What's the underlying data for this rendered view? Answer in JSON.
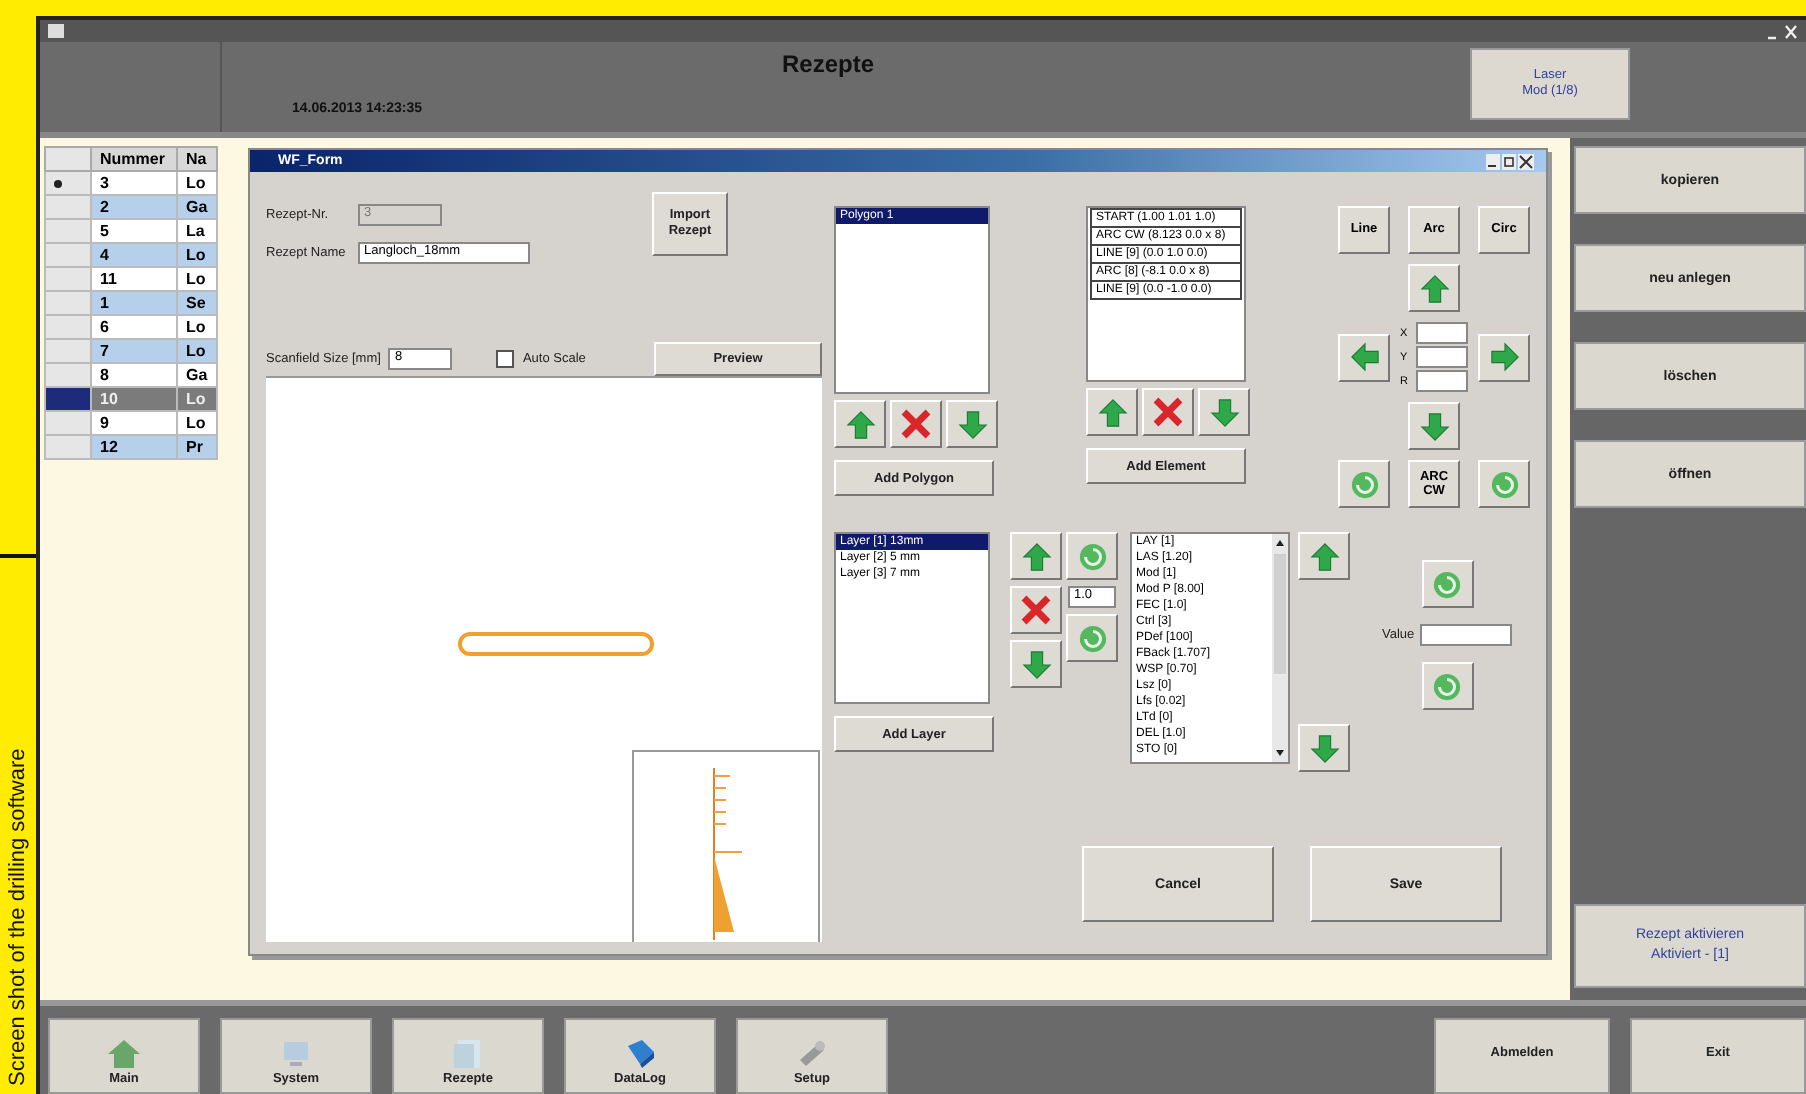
{
  "caption": "Screen shot of the drilling software",
  "header": {
    "title": "Rezepte",
    "datetime": "14.06.2013 14:23:35",
    "mode_button": [
      "Laser",
      "Mod (1/8)"
    ]
  },
  "table": {
    "columns": [
      "Nummer",
      "Na"
    ],
    "rows": [
      {
        "number": "3",
        "name": "Lo",
        "selected": false,
        "current": true
      },
      {
        "number": "2",
        "name": "Ga",
        "selected": false,
        "current": false
      },
      {
        "number": "5",
        "name": "La",
        "selected": false,
        "current": false
      },
      {
        "number": "4",
        "name": "Lo",
        "selected": false,
        "current": false
      },
      {
        "number": "11",
        "name": "Lo",
        "selected": false,
        "current": false
      },
      {
        "number": "1",
        "name": "Se",
        "selected": false,
        "current": false
      },
      {
        "number": "6",
        "name": "Lo",
        "selected": false,
        "current": false
      },
      {
        "number": "7",
        "name": "Lo",
        "selected": false,
        "current": false
      },
      {
        "number": "8",
        "name": "Ga",
        "selected": false,
        "current": false
      },
      {
        "number": "10",
        "name": "Lo",
        "selected": true,
        "current": false
      },
      {
        "number": "9",
        "name": "Lo",
        "selected": false,
        "current": false
      },
      {
        "number": "12",
        "name": "Pr",
        "selected": false,
        "current": false
      }
    ]
  },
  "dialog": {
    "title": "WF_Form",
    "recipe_no_label": "Rezept-Nr.",
    "recipe_no": "3",
    "recipe_name_label": "Rezept Name",
    "recipe_name": "Langloch_18mm",
    "import_button": [
      "Import",
      "Rezept"
    ],
    "scanfield_label": "Scanfield Size [mm]",
    "scanfield": "8",
    "auto_scale": {
      "label": "Auto Scale",
      "checked": false
    },
    "preview_button": "Preview",
    "polygons": [
      {
        "label": "Polygon 1",
        "selected": true
      }
    ],
    "add_polygon": "Add Polygon",
    "elements": [
      {
        "label": "START (1.00 1.01 1.0)",
        "selected": false
      },
      {
        "label": "ARC CW (8.123 0.0 x 8)",
        "selected": false
      },
      {
        "label": "LINE [9] (0.0 1.0 0.0)",
        "selected": false
      },
      {
        "label": "ARC [8] (-8.1 0.0 x 8)",
        "selected": false
      },
      {
        "label": "LINE [9] (0.0 -1.0 0.0)",
        "selected": false
      }
    ],
    "add_element": "Add Element",
    "shape_buttons": [
      "Line",
      "Arc",
      "Circ"
    ],
    "coord_labels": [
      "X",
      "Y",
      "R"
    ],
    "arc_button": [
      "ARC",
      "CW"
    ],
    "layers": [
      {
        "label": "Layer [1] 13mm",
        "selected": true
      },
      {
        "label": "Layer [2] 5 mm",
        "selected": false
      },
      {
        "label": "Layer [3] 7 mm",
        "selected": false
      }
    ],
    "layer_value": "1.0",
    "add_layer": "Add Layer",
    "parameters": [
      "LAY [1]",
      "LAS [1.20]",
      "Mod [1]",
      "Mod P [8.00]",
      "FEC [1.0]",
      "Ctrl [3]",
      "PDef [100]",
      "FBack [1.707]",
      "WSP [0.70]",
      "Lsz [0]",
      "Lfs [0.02]",
      "LTd [0]",
      "DEL [1.0]",
      "STO [0]"
    ],
    "value_label": "Value",
    "cancel_button": "Cancel",
    "save_button": "Save"
  },
  "sidebar": {
    "buttons": [
      "kopieren",
      "neu anlegen",
      "löschen",
      "öffnen"
    ],
    "activate_button": [
      "Rezept aktivieren",
      "Aktiviert - [1]"
    ]
  },
  "nav": [
    "Main",
    "System",
    "Rezepte",
    "DataLog",
    "Setup"
  ],
  "nav_right": [
    "Abmelden",
    "Exit"
  ]
}
